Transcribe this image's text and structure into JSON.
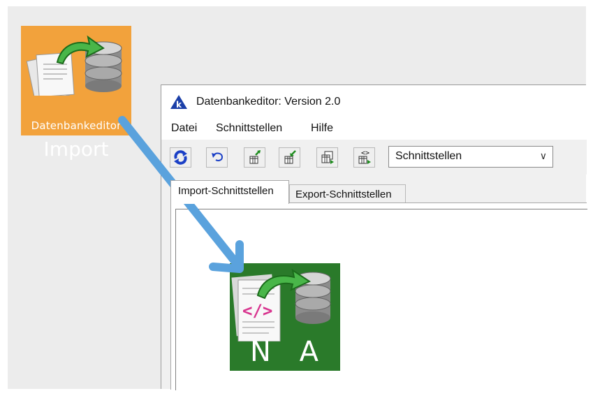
{
  "import_tile": {
    "caption": "Datenbankeditor",
    "label": "Import",
    "icon": "document-database-import-icon",
    "color": "#f2a23c"
  },
  "window": {
    "title": "Datenbankeditor: Version 2.0",
    "app_icon": "k-logo-icon",
    "menu": [
      "Datei",
      "Schnittstellen",
      "Hilfe"
    ],
    "toolbar_icons": [
      "refresh-icon",
      "undo-icon",
      "export-table-icon",
      "import-table-icon",
      "table-copy-icon",
      "table-code-icon"
    ],
    "select": {
      "value": "Schnittstellen"
    },
    "tabs": [
      "Import-Schnittstellen",
      "Export-Schnittstellen"
    ],
    "active_tab": "Import-Schnittstellen"
  },
  "nas_tile": {
    "label": "N A S",
    "icon": "xml-database-import-icon",
    "color": "#2a7a2a"
  },
  "arrow": {
    "color": "#5aa2dd"
  }
}
